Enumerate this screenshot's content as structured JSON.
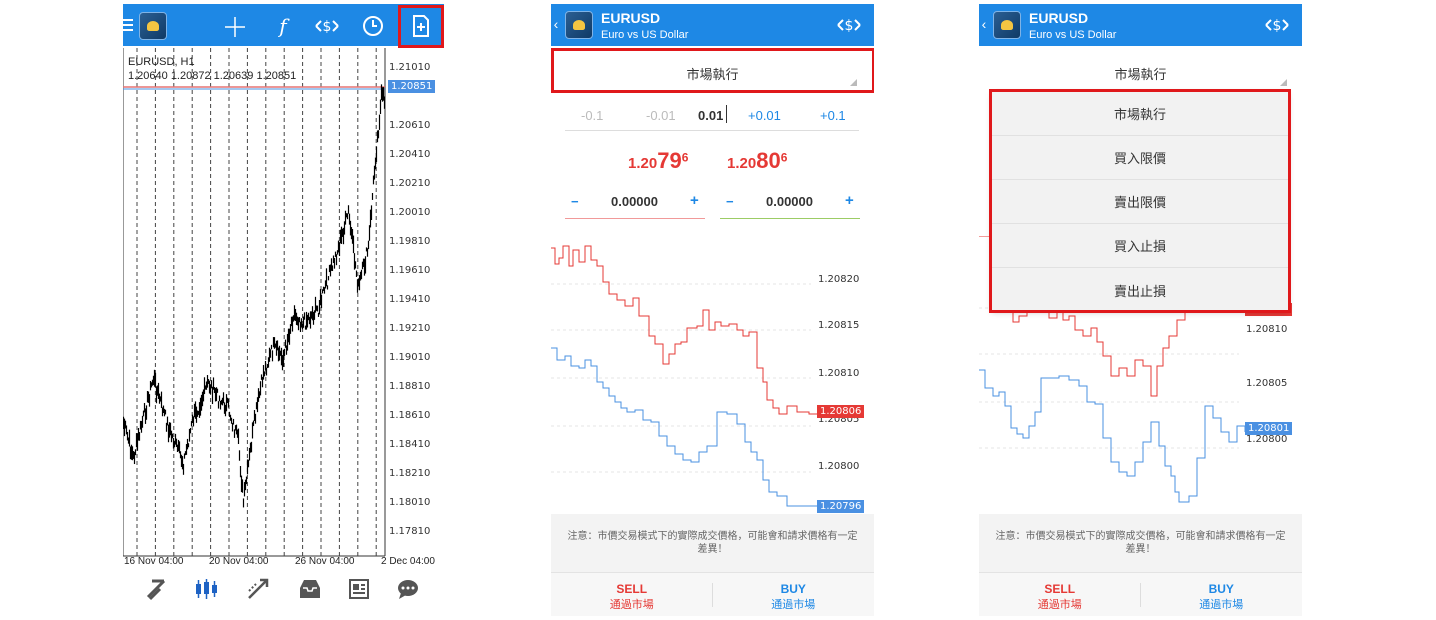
{
  "chart_panel": {
    "symbol_line": "EURUSD, H1",
    "ohlc_line": "1.20640 1.20872 1.20639 1.20851",
    "price_labels": [
      "1.21010",
      "1.20610",
      "1.20410",
      "1.20210",
      "1.20010",
      "1.19810",
      "1.19610",
      "1.19410",
      "1.19210",
      "1.19010",
      "1.18810",
      "1.18610",
      "1.18410",
      "1.18210",
      "1.18010",
      "1.17810"
    ],
    "current_price_tag": "1.20851",
    "date_labels": [
      "16 Nov 04:00",
      "20 Nov 04:00",
      "26 Nov 04:00",
      "2 Dec 04:00"
    ],
    "top_icons": [
      "menu-icon",
      "mt-logo-icon",
      "crosshair-icon",
      "function-icon",
      "dollar-arrows-icon",
      "clock-icon",
      "new-order-icon"
    ],
    "bottom_icons": [
      "quotes-icon",
      "chart-icon",
      "trade-icon",
      "history-icon",
      "news-icon",
      "chat-icon"
    ]
  },
  "order_panel": {
    "back": "‹",
    "symbol": "EURUSD",
    "description": "Euro vs US Dollar",
    "order_type": "市場執行",
    "lot_buttons": [
      "-0.1",
      "-0.01",
      "+0.01",
      "+0.1"
    ],
    "lot_value": "0.01",
    "bid_prefix": "1.20",
    "bid_big": "79",
    "bid_sup": "6",
    "ask_prefix": "1.20",
    "ask_big": "80",
    "ask_sup": "6",
    "stop_loss": "0.00000",
    "take_profit": "0.00000",
    "minus": "−",
    "plus": "+",
    "tick_labels": [
      "1.20820",
      "1.20815",
      "1.20810",
      "1.20805",
      "1.20800"
    ],
    "bid_tag": "1.20806",
    "ask_tag": "1.20796",
    "note": "注意：市價交易模式下的實際成交價格，可能會和請求價格有一定差異！",
    "sell_label": "SELL",
    "sell_sub": "通過市場",
    "buy_label": "BUY",
    "buy_sub": "通過市場"
  },
  "dropdown_panel": {
    "back": "‹",
    "symbol": "EURUSD",
    "description": "Euro vs US Dollar",
    "order_type": "市場執行",
    "options": [
      "市場執行",
      "買入限價",
      "賣出限價",
      "買入止損",
      "賣出止損"
    ],
    "tick_labels": [
      "1.20810",
      "1.20805",
      "1.20800"
    ],
    "bid_tag_partial": "1.20812",
    "ask_tag": "1.20801",
    "note": "注意：市價交易模式下的實際成交價格，可能會和請求價格有一定差異！",
    "sell_label": "SELL",
    "sell_sub": "通過市場",
    "buy_label": "BUY",
    "buy_sub": "通過市場"
  },
  "colors": {
    "header_blue": "#1e88e5",
    "highlight_red": "#e0181b",
    "bid_red": "#e53935",
    "ask_blue": "#1e88e5",
    "sl_line": "#f19999",
    "tp_line": "#9ccc65"
  }
}
